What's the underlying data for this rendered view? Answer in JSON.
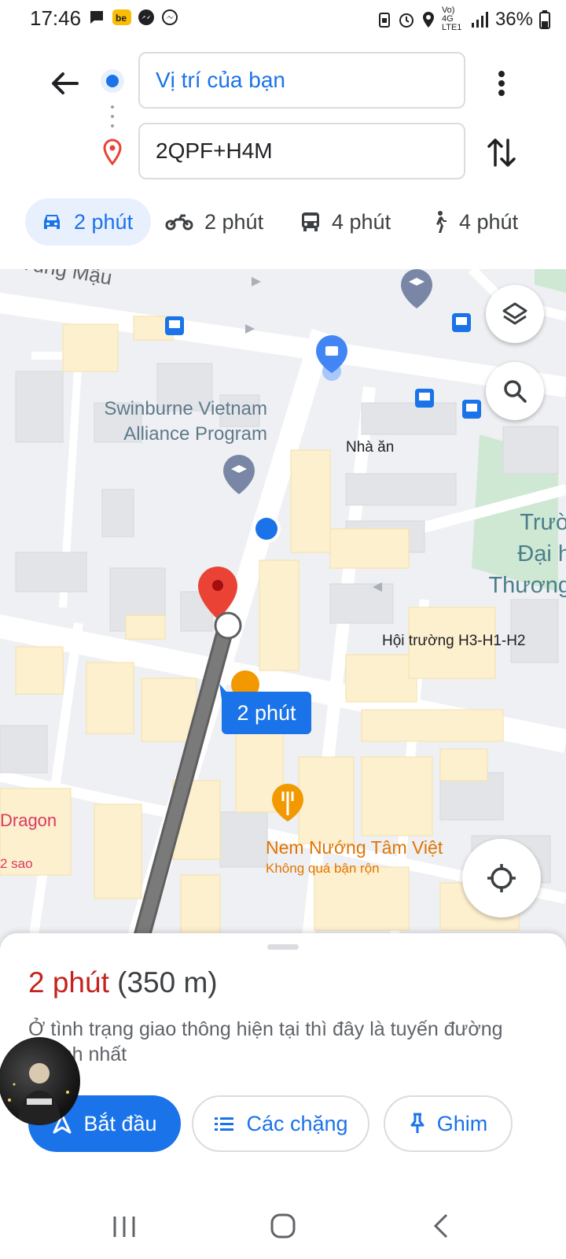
{
  "status_bar": {
    "time": "17:46",
    "battery": "36%",
    "network": "Vo) 4G LTE1",
    "left_icons": [
      "chat-bubble-icon",
      "be-app-icon",
      "messenger-icon",
      "messenger-outline-icon"
    ],
    "right_icons": [
      "lock-battery-icon",
      "alarm-icon",
      "location-icon",
      "signal-icon",
      "battery-icon"
    ]
  },
  "header": {
    "origin": "Vị trí của bạn",
    "destination": "2QPF+H4M"
  },
  "travel_modes": [
    {
      "mode": "car",
      "label": "2 phút",
      "selected": true
    },
    {
      "mode": "motorbike",
      "label": "2 phút",
      "selected": false
    },
    {
      "mode": "transit",
      "label": "4 phút",
      "selected": false
    },
    {
      "mode": "walk",
      "label": "4 phút",
      "selected": false
    }
  ],
  "map": {
    "labels": {
      "street": "Tùng Mậu",
      "swinburne": "Swinburne Vietnam Alliance Program",
      "nha_an": "Nhà ăn",
      "truong": "Trườ Đại h Thương",
      "hoi_truong": "Hội trường H3-H1-H2",
      "dragon": "Dragon",
      "sao": "2 sao",
      "nem_nuong": "Nem Nướng Tâm Việt",
      "nem_status": "Không quá bận rộn"
    },
    "route_duration": "2 phút"
  },
  "sheet": {
    "time": "2 phút",
    "distance": "(350 m)",
    "description": "Ở tình trạng giao thông hiện tại thì đây là tuyến đường nhanh nhất",
    "start": "Bắt đầu",
    "steps": "Các chặng",
    "pin": "Ghim"
  },
  "colors": {
    "accent": "#1a73e8",
    "route": "#7a7a7a",
    "time_red": "#c5221f",
    "pin_red": "#ea4335",
    "food_orange": "#f29900"
  }
}
